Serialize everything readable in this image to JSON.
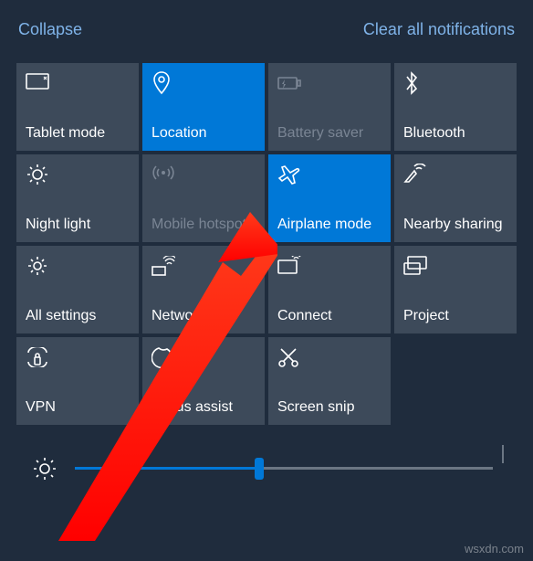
{
  "topbar": {
    "collapse": "Collapse",
    "clear": "Clear all notifications"
  },
  "tiles": [
    {
      "icon": "tablet-mode-icon",
      "label": "Tablet mode",
      "state": "normal"
    },
    {
      "icon": "location-icon",
      "label": "Location",
      "state": "active"
    },
    {
      "icon": "battery-saver-icon",
      "label": "Battery saver",
      "state": "disabled"
    },
    {
      "icon": "bluetooth-icon",
      "label": "Bluetooth",
      "state": "normal"
    },
    {
      "icon": "night-light-icon",
      "label": "Night light",
      "state": "normal"
    },
    {
      "icon": "hotspot-icon",
      "label": "Mobile hotspot",
      "state": "disabled"
    },
    {
      "icon": "airplane-icon",
      "label": "Airplane mode",
      "state": "active"
    },
    {
      "icon": "nearby-icon",
      "label": "Nearby sharing",
      "state": "normal"
    },
    {
      "icon": "settings-icon",
      "label": "All settings",
      "state": "normal"
    },
    {
      "icon": "network-icon",
      "label": "Network",
      "state": "normal"
    },
    {
      "icon": "connect-icon",
      "label": "Connect",
      "state": "normal"
    },
    {
      "icon": "project-icon",
      "label": "Project",
      "state": "normal"
    },
    {
      "icon": "vpn-icon",
      "label": "VPN",
      "state": "normal"
    },
    {
      "icon": "focus-icon",
      "label": "Focus assist",
      "state": "normal"
    },
    {
      "icon": "snip-icon",
      "label": "Screen snip",
      "state": "normal"
    }
  ],
  "brightness": {
    "value": 44
  },
  "watermark": "wsxdn.com",
  "annotation": {
    "type": "arrow",
    "color": "#ff1a1a",
    "target_tile": "Airplane mode"
  }
}
